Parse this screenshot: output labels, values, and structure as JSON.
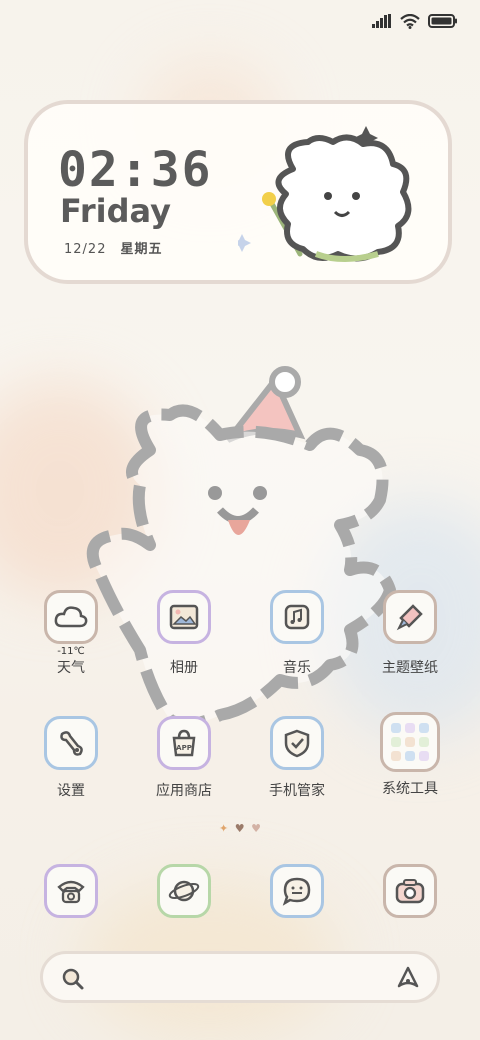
{
  "colors": {
    "text_dark": "#5b5b5b",
    "border_beige": "#c9b6ab",
    "border_purple": "#c6b3e1",
    "border_blue": "#a9c6e3",
    "border_green": "#b7d7a8"
  },
  "status": {
    "signal_icon": "signal-icon",
    "wifi_icon": "wifi-icon",
    "battery_icon": "battery-icon"
  },
  "clock": {
    "time": "02:36",
    "day": "Friday",
    "date": "12/22",
    "weekday": "星期五"
  },
  "apps_row1": [
    {
      "label": "天气",
      "sub": "-11℃",
      "icon": "cloud-icon"
    },
    {
      "label": "相册",
      "icon": "photo-icon"
    },
    {
      "label": "音乐",
      "icon": "music-icon"
    },
    {
      "label": "主题壁纸",
      "icon": "paint-brush-icon"
    }
  ],
  "apps_row2": [
    {
      "label": "设置",
      "icon": "wrench-icon"
    },
    {
      "label": "应用商店",
      "icon": "app-store-icon"
    },
    {
      "label": "手机管家",
      "icon": "shield-icon"
    },
    {
      "label": "系统工具",
      "icon": "folder-icon"
    }
  ],
  "dock": [
    {
      "icon": "phone-icon"
    },
    {
      "icon": "browser-icon"
    },
    {
      "icon": "message-icon"
    },
    {
      "icon": "camera-icon"
    }
  ],
  "page_indicator": {
    "dots": [
      "✦",
      "♥",
      "♥"
    ]
  },
  "search": {
    "left_icon": "search-icon",
    "right_icon": "assistant-icon"
  }
}
